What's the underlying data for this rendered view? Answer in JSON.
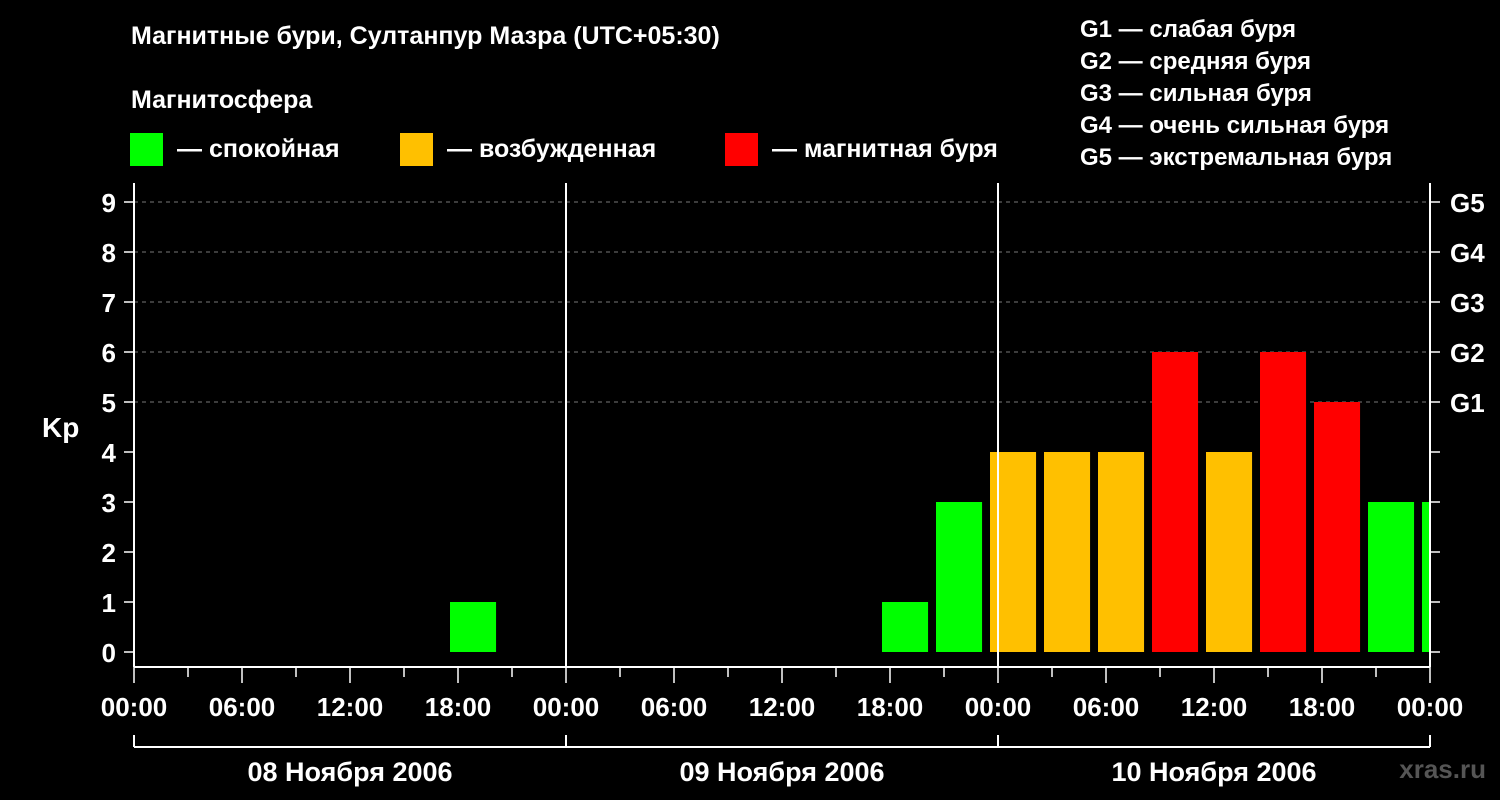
{
  "title": "Магнитные бури, Султанпур Мазра (UTC+05:30)",
  "subtitle": "Магнитосфера",
  "legend": [
    {
      "color": "#00ff00",
      "label": "— спокойная"
    },
    {
      "color": "#ffc000",
      "label": "— возбужденная"
    },
    {
      "color": "#ff0000",
      "label": "— магнитная буря"
    }
  ],
  "g_legend": [
    "G1 — слабая буря",
    "G2 — средняя буря",
    "G3 — сильная буря",
    "G4 — очень сильная буря",
    "G5 — экстремальная буря"
  ],
  "watermark": "xras.ru",
  "chart_data": {
    "type": "bar",
    "ylabel": "Kp",
    "ylim": [
      0,
      9
    ],
    "y_ticks": [
      "0",
      "1",
      "2",
      "3",
      "4",
      "5",
      "6",
      "7",
      "8",
      "9"
    ],
    "right_ticks": [
      {
        "value": 5,
        "label": "G1"
      },
      {
        "value": 6,
        "label": "G2"
      },
      {
        "value": 7,
        "label": "G3"
      },
      {
        "value": 8,
        "label": "G4"
      },
      {
        "value": 9,
        "label": "G5"
      }
    ],
    "x_tick_labels": [
      "00:00",
      "06:00",
      "12:00",
      "18:00",
      "00:00",
      "06:00",
      "12:00",
      "18:00",
      "00:00",
      "06:00",
      "12:00",
      "18:00",
      "00:00"
    ],
    "days": [
      "08 Ноября 2006",
      "09 Ноября 2006",
      "10 Ноября 2006"
    ],
    "colors": {
      "quiet": "#00ff00",
      "active": "#ffc000",
      "storm": "#ff0000"
    },
    "bars": [
      {
        "start_hour": 17.5,
        "kp": 1,
        "level": "quiet"
      },
      {
        "start_hour": 41.5,
        "kp": 1,
        "level": "quiet"
      },
      {
        "start_hour": 44.5,
        "kp": 3,
        "level": "quiet"
      },
      {
        "start_hour": 47.5,
        "kp": 4,
        "level": "active"
      },
      {
        "start_hour": 50.5,
        "kp": 4,
        "level": "active"
      },
      {
        "start_hour": 53.5,
        "kp": 4,
        "level": "active"
      },
      {
        "start_hour": 56.5,
        "kp": 6,
        "level": "storm"
      },
      {
        "start_hour": 59.5,
        "kp": 4,
        "level": "active"
      },
      {
        "start_hour": 62.5,
        "kp": 6,
        "level": "storm"
      },
      {
        "start_hour": 65.5,
        "kp": 5,
        "level": "storm"
      },
      {
        "start_hour": 68.5,
        "kp": 3,
        "level": "quiet"
      },
      {
        "start_hour": 71.5,
        "kp": 3,
        "level": "quiet",
        "end_hour": 72
      }
    ],
    "grid": true
  }
}
